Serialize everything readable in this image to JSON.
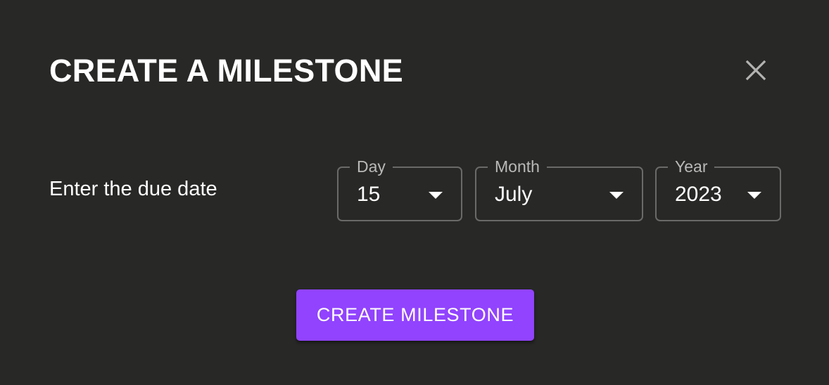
{
  "dialog": {
    "title": "CREATE A MILESTONE",
    "close_icon": "close-icon"
  },
  "due_date": {
    "label": "Enter the due date",
    "day": {
      "legend": "Day",
      "value": "15"
    },
    "month": {
      "legend": "Month",
      "value": "July"
    },
    "year": {
      "legend": "Year",
      "value": "2023"
    }
  },
  "actions": {
    "create_label": "CREATE MILESTONE"
  },
  "colors": {
    "background": "#282827",
    "accent": "#9143fd",
    "outline": "#6a6a69",
    "text": "#ffffff",
    "muted_text": "#b9b9b8"
  }
}
